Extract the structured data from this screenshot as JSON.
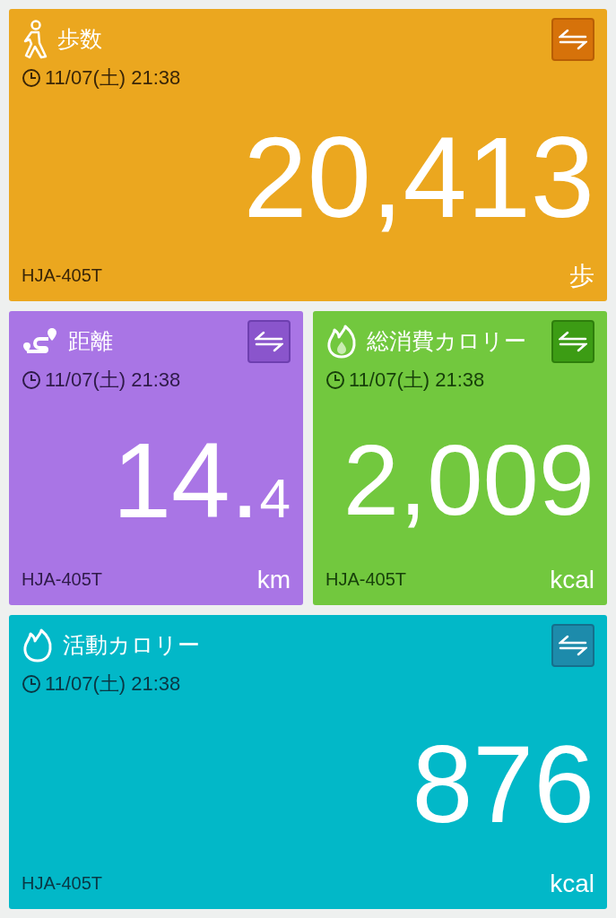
{
  "cards": [
    {
      "kind": "steps",
      "title": "歩数",
      "date": "11/07(土) 21:38",
      "value": "20,413",
      "unit": "歩",
      "device": "HJA-405T"
    },
    {
      "kind": "distance",
      "title": "距離",
      "date": "11/07(土) 21:38",
      "value": "14.",
      "decimal": "4",
      "unit": "km",
      "device": "HJA-405T"
    },
    {
      "kind": "total_calories",
      "title": "総消費カロリー",
      "date": "11/07(土) 21:38",
      "value": "2,009",
      "unit": "kcal",
      "device": "HJA-405T"
    },
    {
      "kind": "active_calories",
      "title": "活動カロリー",
      "date": "11/07(土) 21:38",
      "value": "876",
      "unit": "kcal",
      "device": "HJA-405T"
    }
  ]
}
